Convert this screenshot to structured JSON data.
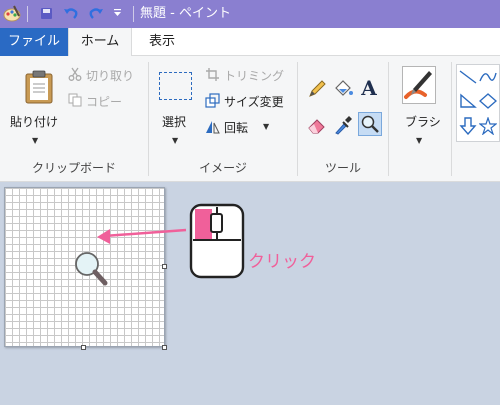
{
  "title_bar": {
    "title": "無題 - ペイント",
    "quick_access": [
      "save-icon",
      "undo-icon",
      "redo-icon",
      "customize-dropdown"
    ]
  },
  "tabs": [
    {
      "label": "ファイル",
      "active": false
    },
    {
      "label": "ホーム",
      "active": true
    },
    {
      "label": "表示",
      "active": false
    }
  ],
  "ribbon": {
    "clipboard": {
      "label": "クリップボード",
      "paste": "貼り付け",
      "cut": "切り取り",
      "copy": "コピー"
    },
    "image": {
      "label": "イメージ",
      "select": "選択",
      "crop": "トリミング",
      "resize": "サイズ変更",
      "rotate": "回転"
    },
    "tools": {
      "label": "ツール",
      "items": [
        "pencil-icon",
        "fill-icon",
        "text-icon",
        "eraser-icon",
        "color-picker-icon",
        "magnifier-icon"
      ],
      "selected": "magnifier-icon"
    },
    "brushes": {
      "label": "ブラシ"
    },
    "shapes": {
      "items": [
        "line-icon",
        "curve-icon",
        "triangle-icon",
        "diamond-icon",
        "arrow-down-icon",
        "star-icon"
      ]
    }
  },
  "annotation": {
    "text": "クリック",
    "color": "#f0609a"
  },
  "colors": {
    "title_bar": "#8a7fd0",
    "file_tab": "#2a6ac4",
    "ribbon_bg": "#f5f6f7",
    "workspace_bg": "#c9d3e2",
    "accent_pink": "#f0609a",
    "selected_tool": "#c6dcf4"
  }
}
